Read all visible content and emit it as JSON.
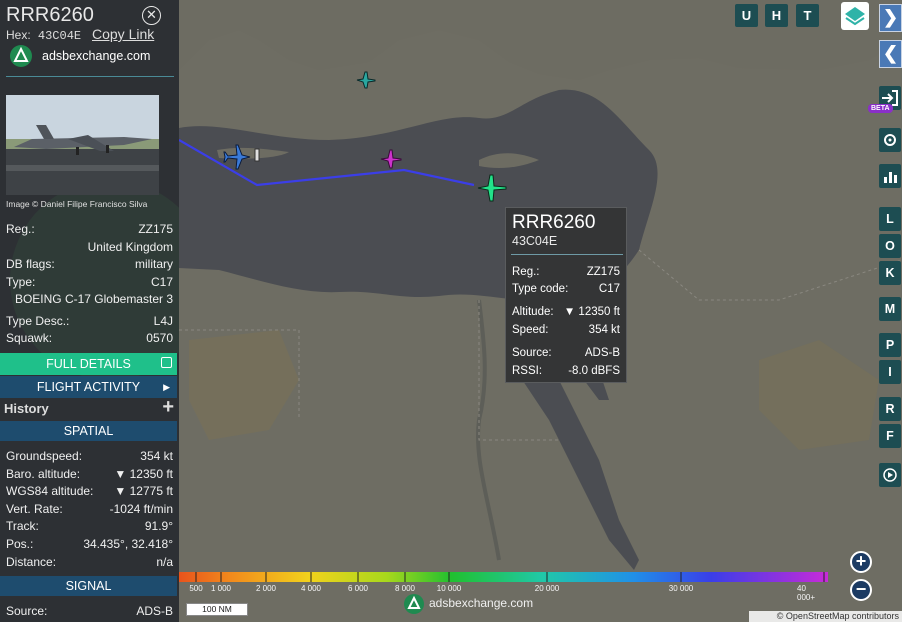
{
  "aircraft": {
    "callsign": "RRR6260",
    "hex_label": "Hex:",
    "hex": "43C04E",
    "copy_link": "Copy Link",
    "site": "adsbexchange.com",
    "photo_credit": "Image © Daniel Filipe Francisco Silva"
  },
  "details": {
    "reg_label": "Reg.:",
    "reg": "ZZ175",
    "country": "United Kingdom",
    "dbflags_label": "DB flags:",
    "dbflags": "military",
    "type_label": "Type:",
    "type": "C17",
    "model": "BOEING C-17 Globemaster 3",
    "typedesc_label": "Type Desc.:",
    "typedesc": "L4J",
    "squawk_label": "Squawk:",
    "squawk": "0570"
  },
  "buttons": {
    "full_details": "FULL DETAILS",
    "flight_activity": "FLIGHT ACTIVITY",
    "history": "History",
    "history_plus": "+"
  },
  "spatial": {
    "header": "SPATIAL",
    "groundspeed_label": "Groundspeed:",
    "groundspeed": "354 kt",
    "baro_label": "Baro. altitude:",
    "baro": "▼ 12350 ft",
    "wgs_label": "WGS84 altitude:",
    "wgs": "▼ 12775 ft",
    "vrate_label": "Vert. Rate:",
    "vrate": "-1024 ft/min",
    "track_label": "Track:",
    "track": "91.9°",
    "pos_label": "Pos.:",
    "pos": "34.435°, 32.418°",
    "distance_label": "Distance:",
    "distance": "n/a"
  },
  "signal": {
    "header": "SIGNAL",
    "source_label": "Source:",
    "source": "ADS-B"
  },
  "tooltip": {
    "callsign": "RRR6260",
    "hex": "43C04E",
    "reg_label": "Reg.:",
    "reg": "ZZ175",
    "typecode_label": "Type code:",
    "typecode": "C17",
    "alt_label": "Altitude:",
    "alt": "▼ 12350 ft",
    "speed_label": "Speed:",
    "speed": "354 kt",
    "source_label": "Source:",
    "source": "ADS-B",
    "rssi_label": "RSSI:",
    "rssi": "-8.0 dBFS"
  },
  "top_buttons": [
    "U",
    "H",
    "T"
  ],
  "right_buttons": [
    "L",
    "O",
    "K",
    "M",
    "P",
    "I",
    "R",
    "F"
  ],
  "beta_badge": "BETA",
  "altitude_legend": {
    "labels": [
      "500",
      "1 000",
      "2 000",
      "4 000",
      "6 000",
      "8 000",
      "10 000",
      "20 000",
      "30 000",
      "40 000+"
    ]
  },
  "scale_label": "100 NM",
  "footer_site": "adsbexchange.com",
  "osm_attribution": "© OpenStreetMap contributors",
  "zoom": {
    "in": "+",
    "out": "−"
  },
  "nav": {
    "forward": "❯",
    "back": "❮"
  },
  "colors": {
    "sidebar_bg": "#2d3034",
    "accent_green": "#1fc08a",
    "section_blue": "#1e4c6e",
    "map_button": "#1d4d52",
    "track_line": "#3b3ee8",
    "selected_aircraft": "#22e38a"
  }
}
